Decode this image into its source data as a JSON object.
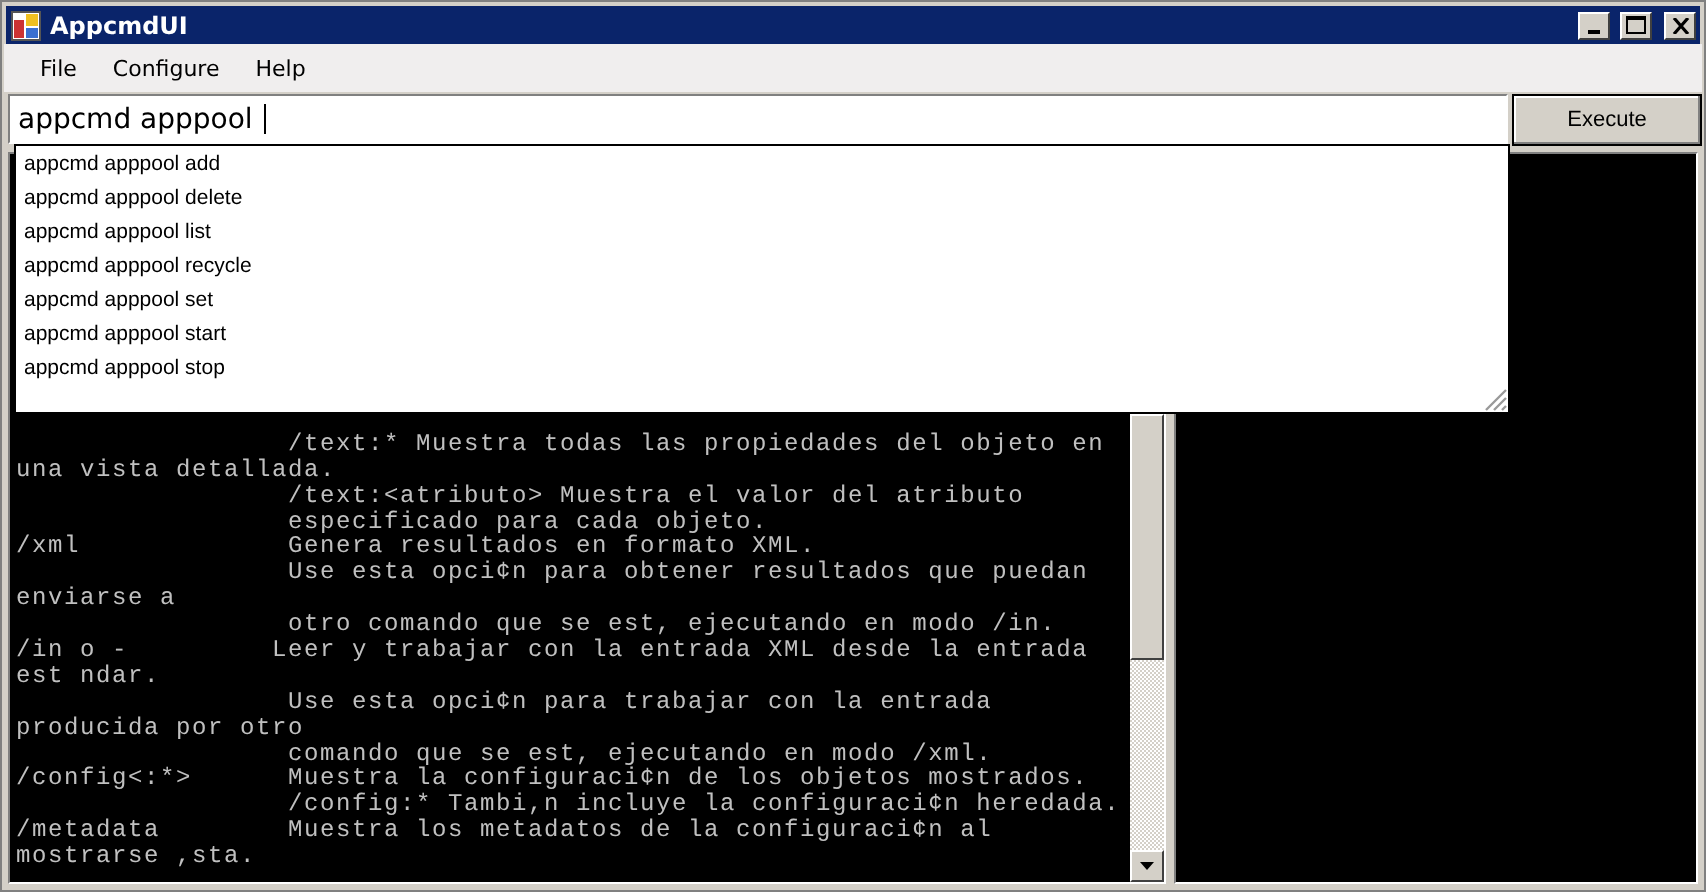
{
  "window": {
    "title": "AppcmdUI"
  },
  "menu": [
    {
      "label": "File"
    },
    {
      "label": "Configure"
    },
    {
      "label": "Help"
    }
  ],
  "command": {
    "value": "appcmd apppool "
  },
  "execute_button": {
    "label": "Execute"
  },
  "suggestions": [
    {
      "label": "appcmd apppool add"
    },
    {
      "label": "appcmd apppool delete"
    },
    {
      "label": "appcmd apppool list"
    },
    {
      "label": "appcmd apppool recycle"
    },
    {
      "label": "appcmd apppool set"
    },
    {
      "label": "appcmd apppool start"
    },
    {
      "label": "appcmd apppool stop"
    }
  ],
  "console_lines": [
    "                 /text:* Muestra todas las propiedades del objeto en",
    "una vista detallada.",
    "                 /text:<atributo> Muestra el valor del atributo",
    "                 especificado para cada objeto.",
    "/xml             Genera resultados en formato XML.",
    "                 Use esta opci¢n para obtener resultados que puedan",
    "enviarse a",
    "                 otro comando que se est, ejecutando en modo /in.",
    "/in o -         Leer y trabajar con la entrada XML desde la entrada",
    "est ndar.",
    "                 Use esta opci¢n para trabajar con la entrada",
    "producida por otro",
    "                 comando que se est, ejecutando en modo /xml.",
    "/config<:*>      Muestra la configuraci¢n de los objetos mostrados.",
    "                 /config:* Tambi,n incluye la configuraci¢n heredada.",
    "/metadata        Muestra los metadatos de la configuraci¢n al",
    "mostrarse ,sta."
  ]
}
